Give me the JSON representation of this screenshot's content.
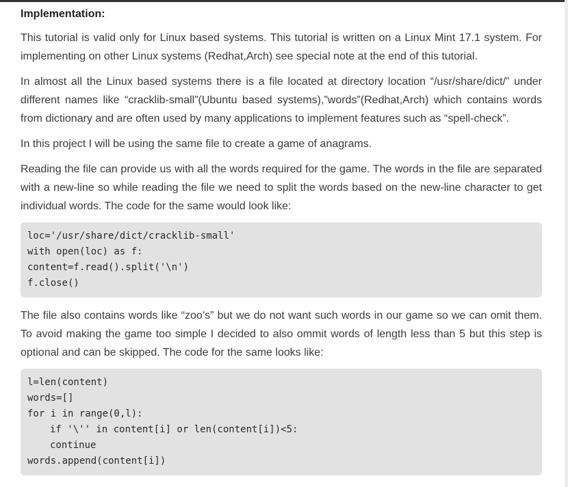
{
  "section": {
    "heading": "Implementation:",
    "paragraphs": [
      "This tutorial is valid only for Linux based systems. This tutorial is written on a Linux Mint 17.1 system. For implementing on other Linux systems (Redhat,Arch) see special note at the end of this tutorial.",
      "In almost all the Linux based systems there is a file located at directory location “/usr/share/dict/” under different names like “cracklib-small”(Ubuntu based systems),”words”(Redhat,Arch) which contains words from dictionary and are often used by many applications to implement features such as “spell-check”.",
      "In this project I will be using the same file to create a game of anagrams.",
      "Reading the file can provide us with all the words required for the game. The words in the file are separated with a new-line so while reading the file we need to split the words based on the new-line character to get individual words. The code for the same would look like:",
      "The file also contains words like “zoo’s” but we do not want such words in our game so we can omit them. To avoid making the game too simple I decided to also ommit words of length less than 5 but this step is optional and can be skipped. The code for the same looks like:"
    ],
    "code_blocks": [
      {
        "lines": [
          "loc='/usr/share/dict/cracklib-small'",
          "with open(loc) as f:",
          "content=f.read().split('\\n')",
          "f.close()"
        ]
      },
      {
        "lines": [
          "l=len(content)",
          "words=[]",
          "for i in range(0,l):",
          "if '\\'' in content[i] or len(content[i])<5:",
          "continue",
          "words.append(content[i])"
        ]
      }
    ]
  }
}
